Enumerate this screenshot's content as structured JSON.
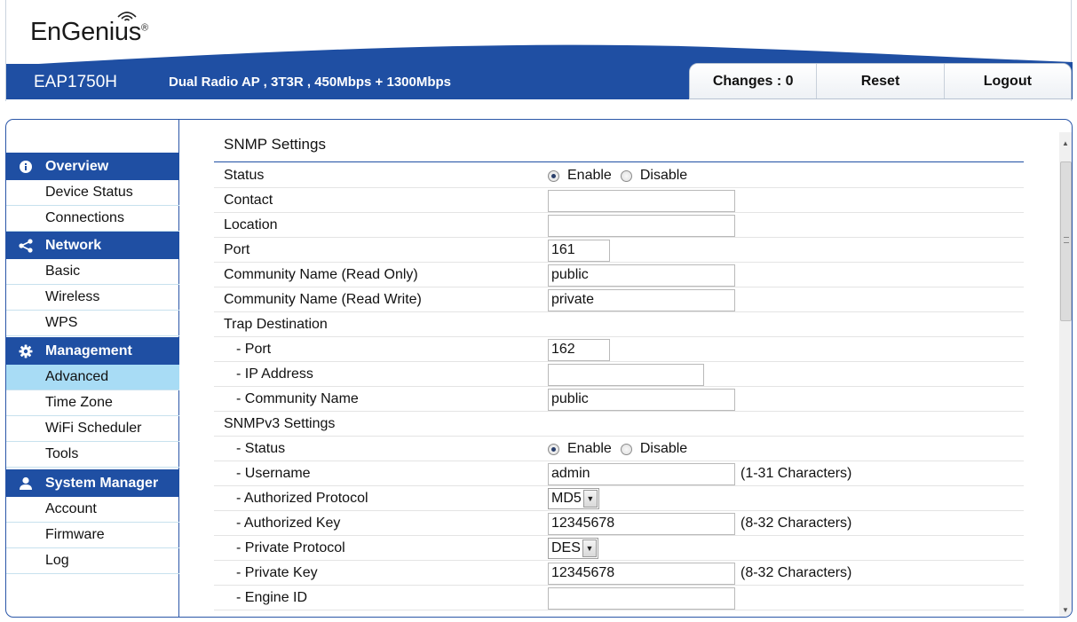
{
  "header": {
    "logo": "EnGenius",
    "logo_mark": "®",
    "model": "EAP1750H",
    "description": "Dual Radio AP , 3T3R , 450Mbps + 1300Mbps",
    "buttons": {
      "changes": "Changes : 0",
      "reset": "Reset",
      "logout": "Logout"
    }
  },
  "sidebar": {
    "overview": {
      "title": "Overview",
      "icon": "info-icon",
      "items": [
        "Device Status",
        "Connections"
      ]
    },
    "network": {
      "title": "Network",
      "icon": "share-icon",
      "items": [
        "Basic",
        "Wireless",
        "WPS"
      ]
    },
    "management": {
      "title": "Management",
      "icon": "gear-icon",
      "items": [
        "Advanced",
        "Time Zone",
        "WiFi Scheduler",
        "Tools"
      ]
    },
    "system": {
      "title": "System Manager",
      "icon": "user-icon",
      "items": [
        "Account",
        "Firmware",
        "Log"
      ]
    },
    "active_item": "Advanced"
  },
  "snmp": {
    "title": "SNMP Settings",
    "status": {
      "label": "Status",
      "enable": "Enable",
      "disable": "Disable",
      "selected": "Enable"
    },
    "contact": {
      "label": "Contact",
      "value": ""
    },
    "location": {
      "label": "Location",
      "value": ""
    },
    "port": {
      "label": "Port",
      "value": "161"
    },
    "community_ro": {
      "label": "Community Name (Read Only)",
      "value": "public"
    },
    "community_rw": {
      "label": "Community Name (Read Write)",
      "value": "private"
    },
    "trap": {
      "label": "Trap Destination",
      "port": {
        "label": "- Port",
        "value": "162"
      },
      "ip": {
        "label": "- IP Address",
        "value": ""
      },
      "community": {
        "label": "- Community Name",
        "value": "public"
      }
    },
    "v3": {
      "label": "SNMPv3 Settings",
      "status": {
        "label": "- Status",
        "enable": "Enable",
        "disable": "Disable",
        "selected": "Enable"
      },
      "username": {
        "label": "- Username",
        "value": "admin",
        "hint": "(1-31 Characters)"
      },
      "auth_protocol": {
        "label": "- Authorized Protocol",
        "value": "MD5"
      },
      "auth_key": {
        "label": "- Authorized Key",
        "value": "12345678",
        "hint": "(8-32 Characters)"
      },
      "priv_protocol": {
        "label": "- Private Protocol",
        "value": "DES"
      },
      "priv_key": {
        "label": "- Private Key",
        "value": "12345678",
        "hint": "(8-32 Characters)"
      },
      "engine_id": {
        "label": "- Engine ID",
        "value": ""
      }
    }
  },
  "colors": {
    "brand_blue": "#1f4fa3",
    "active_item": "#a8dcf5"
  }
}
